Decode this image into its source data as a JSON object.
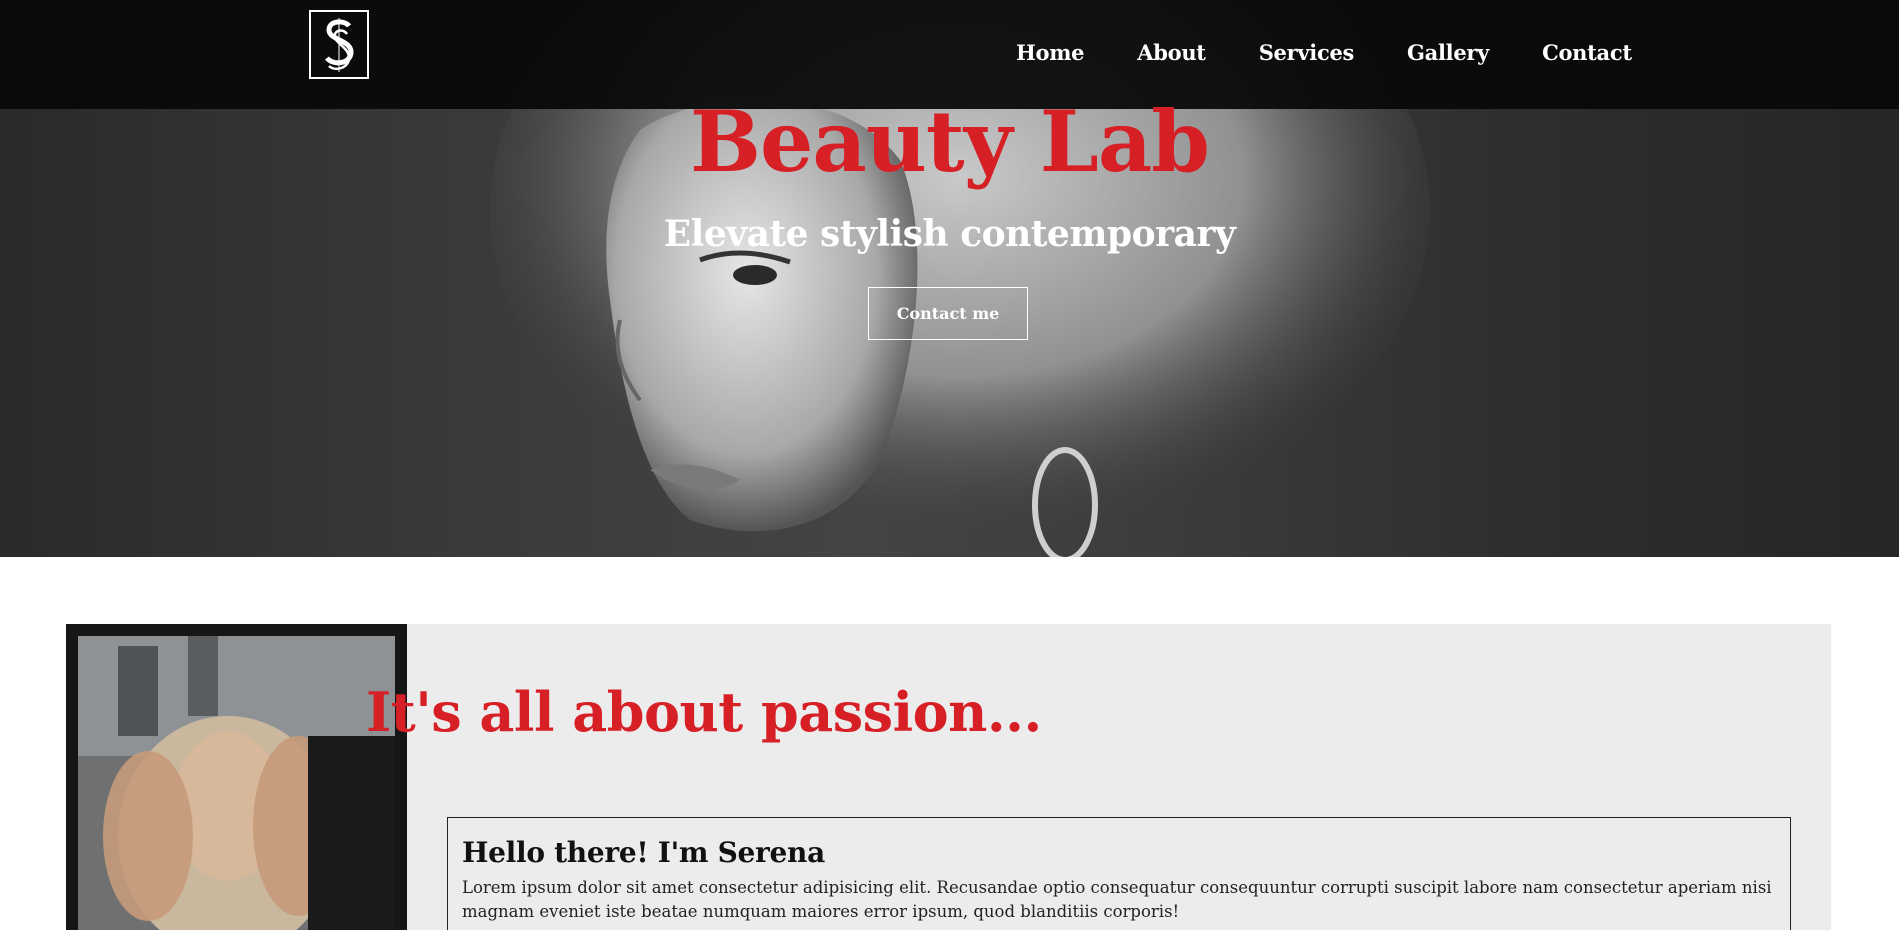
{
  "nav": {
    "logo_icon": "monogram-s-logo",
    "links": [
      "Home",
      "About",
      "Services",
      "Gallery",
      "Contact"
    ]
  },
  "hero": {
    "title": "Beauty Lab",
    "subtitle": "Elevate stylish contemporary",
    "cta_label": "Contact me"
  },
  "about": {
    "heading": "It's all about passion...",
    "card_title": "Hello there! I'm Serena",
    "card_text": "Lorem ipsum dolor sit amet consectetur adipisicing elit. Recusandae optio consequatur consequuntur corrupti suscipit labore nam consectetur aperiam nisi magnam eveniet iste beatae numquam maiores error ipsum, quod blanditiis corporis!"
  },
  "colors": {
    "accent": "#d71f26",
    "navbar": "#080808",
    "section_bg": "#ececec"
  }
}
